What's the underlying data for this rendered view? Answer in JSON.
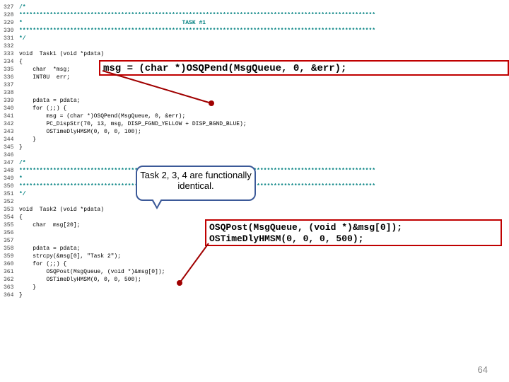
{
  "code": {
    "lines": [
      {
        "n": "327",
        "t": "/*"
      },
      {
        "n": "328",
        "t": "*********************************************************************************************************"
      },
      {
        "n": "329",
        "t": "*                                               TASK #1"
      },
      {
        "n": "330",
        "t": "*********************************************************************************************************"
      },
      {
        "n": "331",
        "t": "*/"
      },
      {
        "n": "332",
        "t": ""
      },
      {
        "n": "333",
        "t": "void  Task1 (void *pdata)"
      },
      {
        "n": "334",
        "t": "{"
      },
      {
        "n": "335",
        "t": "    char  *msg;"
      },
      {
        "n": "336",
        "t": "    INT8U  err;"
      },
      {
        "n": "337",
        "t": ""
      },
      {
        "n": "338",
        "t": ""
      },
      {
        "n": "339",
        "t": "    pdata = pdata;"
      },
      {
        "n": "340",
        "t": "    for (;;) {"
      },
      {
        "n": "341",
        "t": "        msg = (char *)OSQPend(MsgQueue, 0, &err);"
      },
      {
        "n": "342",
        "t": "        PC_DispStr(70, 13, msg, DISP_FGND_YELLOW + DISP_BGND_BLUE);"
      },
      {
        "n": "343",
        "t": "        OSTimeDlyHMSM(0, 0, 0, 100);"
      },
      {
        "n": "344",
        "t": "    }"
      },
      {
        "n": "345",
        "t": "}"
      },
      {
        "n": "346",
        "t": ""
      },
      {
        "n": "347",
        "t": "/*"
      },
      {
        "n": "348",
        "t": "*********************************************************************************************************"
      },
      {
        "n": "349",
        "t": "*"
      },
      {
        "n": "350",
        "t": "*********************************************************************************************************"
      },
      {
        "n": "351",
        "t": "*/"
      },
      {
        "n": "352",
        "t": ""
      },
      {
        "n": "353",
        "t": "void  Task2 (void *pdata)"
      },
      {
        "n": "354",
        "t": "{"
      },
      {
        "n": "355",
        "t": "    char  msg[20];"
      },
      {
        "n": "356",
        "t": ""
      },
      {
        "n": "357",
        "t": ""
      },
      {
        "n": "358",
        "t": "    pdata = pdata;"
      },
      {
        "n": "359",
        "t": "    strcpy(&msg[0], \"Task 2\");"
      },
      {
        "n": "360",
        "t": "    for (;;) {"
      },
      {
        "n": "361",
        "t": "        OSQPost(MsgQueue, (void *)&msg[0]);"
      },
      {
        "n": "362",
        "t": "        OSTimeDlyHMSM(0, 0, 0, 500);"
      },
      {
        "n": "363",
        "t": "    }"
      },
      {
        "n": "364",
        "t": "}"
      }
    ],
    "teal_lines": [
      "327",
      "328",
      "329",
      "330",
      "331",
      "347",
      "348",
      "349",
      "350",
      "351"
    ]
  },
  "callout1": "msg = (char *)OSQPend(MsgQueue, 0, &err);",
  "callout2_line1": "OSQPost(MsgQueue, (void *)&msg[0]);",
  "callout2_line2": "OSTimeDlyHMSM(0, 0, 0, 500);",
  "speech_text": "Task 2, 3, 4 are functionally identical.",
  "page_number": "64"
}
